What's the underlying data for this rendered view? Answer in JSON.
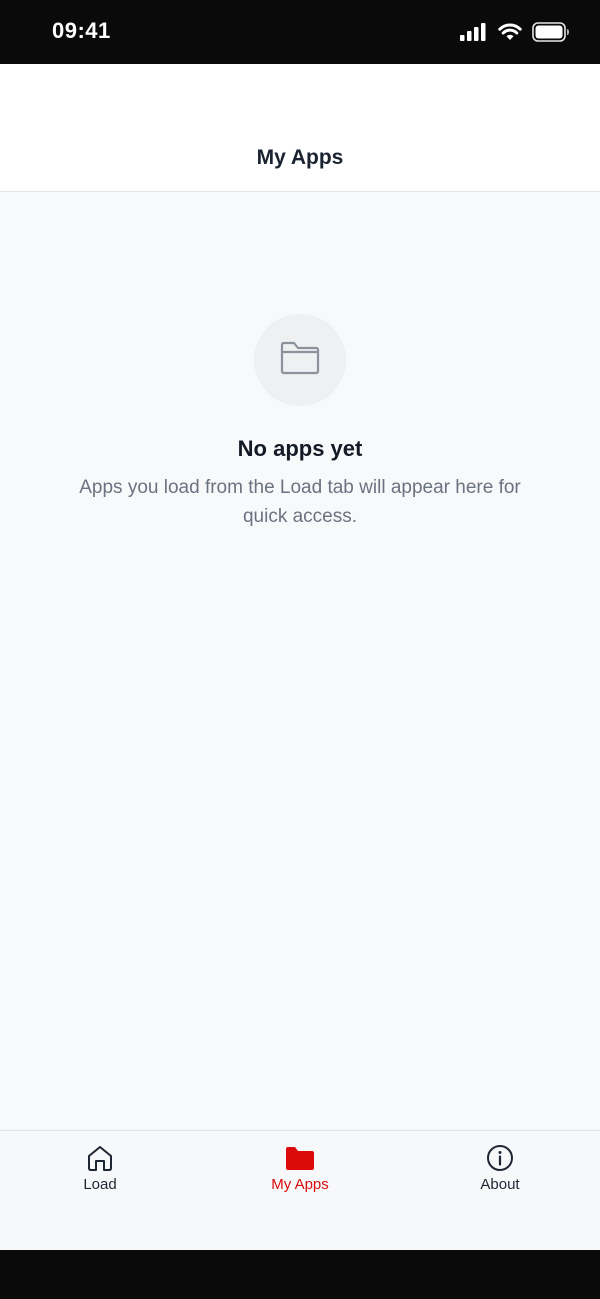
{
  "status_bar": {
    "time": "09:41",
    "icons": [
      "signal-icon",
      "wifi-icon",
      "battery-icon"
    ]
  },
  "header": {
    "title": "My Apps"
  },
  "empty_state": {
    "icon": "folder-icon",
    "title": "No apps yet",
    "message": "Apps you load from the Load tab will appear here for quick access."
  },
  "tabs": [
    {
      "label": "Load",
      "icon": "home-icon",
      "active": false
    },
    {
      "label": "My Apps",
      "icon": "folder-icon",
      "active": true
    },
    {
      "label": "About",
      "icon": "info-icon",
      "active": false
    }
  ],
  "colors": {
    "accent": "#dc0b0b",
    "text_primary": "#141a26",
    "text_secondary": "#6b7280",
    "background": "#f8f9fb"
  }
}
